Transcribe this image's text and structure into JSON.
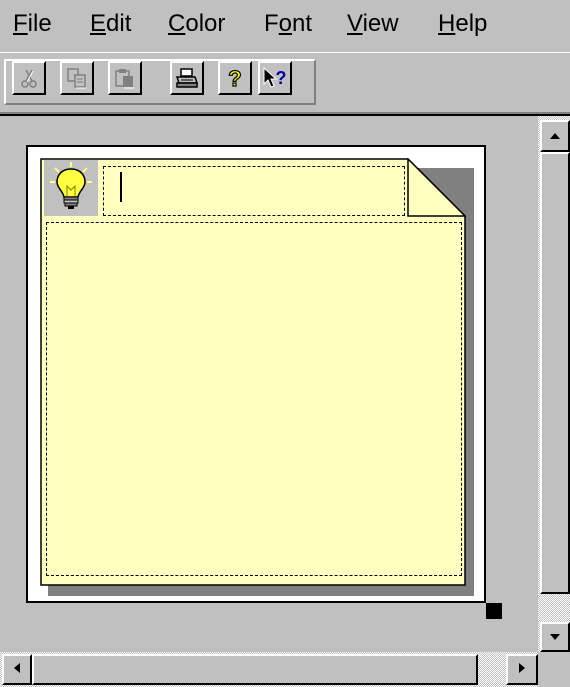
{
  "menu": {
    "items": [
      {
        "accel": "F",
        "rest": "ile"
      },
      {
        "accel": "E",
        "rest": "dit"
      },
      {
        "accel": "C",
        "rest": "olor"
      },
      {
        "pre": "F",
        "accel": "o",
        "rest": "nt"
      },
      {
        "accel": "V",
        "rest": "iew"
      },
      {
        "accel": "H",
        "rest": "elp"
      }
    ]
  },
  "toolbar": {
    "buttons": [
      {
        "icon": "cut-icon",
        "enabled": false
      },
      {
        "icon": "copy-icon",
        "enabled": false
      },
      {
        "icon": "paste-icon",
        "enabled": false
      },
      {
        "icon": "print-icon",
        "enabled": true
      },
      {
        "icon": "help-icon",
        "enabled": true
      },
      {
        "icon": "context-help-icon",
        "enabled": true
      }
    ]
  },
  "note": {
    "title": "",
    "body": "",
    "icon": "lightbulb-icon",
    "color": "#ffffc0"
  }
}
